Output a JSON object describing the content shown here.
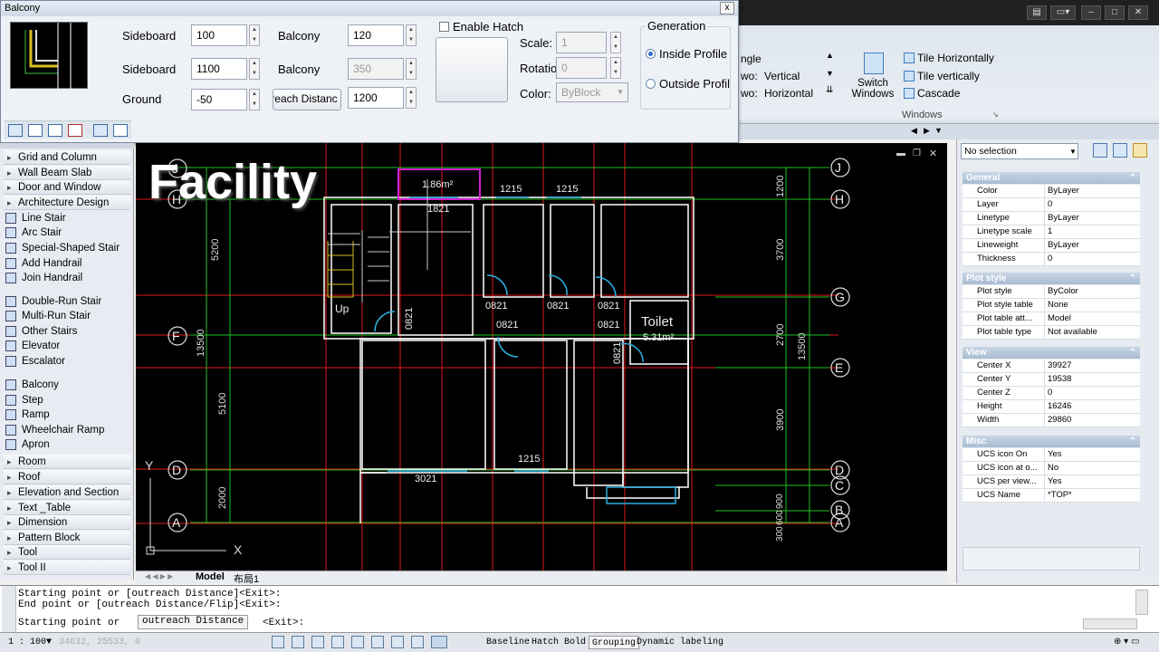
{
  "dialog": {
    "title": "Balcony",
    "close": "x",
    "rows": [
      {
        "label1": "Sideboard",
        "value1": "100",
        "label2": "Balcony",
        "value2": "120"
      },
      {
        "label1": "Sideboard",
        "value1": "1100",
        "label2": "Balcony",
        "value2": "350"
      },
      {
        "label1": "Ground",
        "value1": "-50",
        "button2": "reach Distanc",
        "value2": "1200"
      }
    ],
    "hatch": {
      "checkbox_label": "Enable Hatch",
      "scale_label": "Scale:",
      "scale_value": "1",
      "rotation_label": "Rotatio",
      "rotation_value": "0",
      "color_label": "Color:",
      "color_value": "ByBlock"
    },
    "generation": {
      "title": "Generation",
      "option1": "Inside Profile",
      "option2": "Outside Profil",
      "selected": "Inside Profile"
    }
  },
  "ribbon": {
    "angle_label": "ngle",
    "two_label": "wo:",
    "vertical": "Vertical",
    "two_label_2": "wo:",
    "horizontal": "Horizontal",
    "switch_windows": "Switch Windows",
    "tile_h": "Tile Horizontally",
    "tile_v": "Tile vertically",
    "cascade": "Cascade",
    "group_label": "Windows"
  },
  "left_panel": {
    "items": [
      {
        "type": "head",
        "label": "Grid and Column"
      },
      {
        "type": "head",
        "label": "Wall Beam Slab"
      },
      {
        "type": "head",
        "label": "Door and Window"
      },
      {
        "type": "head",
        "label": "Architecture Design"
      },
      {
        "type": "sub",
        "label": "Line Stair"
      },
      {
        "type": "sub",
        "label": "Arc Stair"
      },
      {
        "type": "sub",
        "label": "Special-Shaped Stair"
      },
      {
        "type": "sub",
        "label": "Add Handrail"
      },
      {
        "type": "sub",
        "label": "Join Handrail"
      },
      {
        "type": "sub",
        "label": "Double-Run Stair"
      },
      {
        "type": "sub",
        "label": "Multi-Run Stair"
      },
      {
        "type": "sub",
        "label": "Other Stairs"
      },
      {
        "type": "sub",
        "label": "Elevator"
      },
      {
        "type": "sub",
        "label": "Escalator"
      },
      {
        "type": "sub",
        "label": "Balcony"
      },
      {
        "type": "sub",
        "label": "Step"
      },
      {
        "type": "sub",
        "label": "Ramp"
      },
      {
        "type": "sub",
        "label": "Wheelchair Ramp"
      },
      {
        "type": "sub",
        "label": "Apron"
      },
      {
        "type": "head",
        "label": "Room"
      },
      {
        "type": "head",
        "label": "Roof"
      },
      {
        "type": "head",
        "label": "Elevation and Section"
      },
      {
        "type": "head",
        "label": "Text _Table"
      },
      {
        "type": "head",
        "label": "Dimension"
      },
      {
        "type": "head",
        "label": "Pattern Block"
      },
      {
        "type": "head",
        "label": "Tool"
      },
      {
        "type": "head",
        "label": "Tool II"
      }
    ]
  },
  "canvas": {
    "overlay_title": "Facility",
    "axis_labels_right": [
      "J",
      "H",
      "G",
      "E",
      "D",
      "C",
      "B",
      "A"
    ],
    "axis_labels_left": [
      "J",
      "H",
      "F",
      "D",
      "A"
    ],
    "dims_left": [
      "5200",
      "13500",
      "5100",
      "2000"
    ],
    "dims_right": [
      "1200",
      "3700",
      "2700",
      "3900",
      "900",
      "600",
      "300",
      "13500"
    ],
    "labels": {
      "area1": "1.86m²",
      "w1821": "1821",
      "d1215a": "1215",
      "d1215b": "1215",
      "up": "Up",
      "d0821a": "0821",
      "d0821b": "0821",
      "d0821c": "0821",
      "d0821d": "0821",
      "d0821e": "0821",
      "d0821f": "0821",
      "d0821g": "0821",
      "toilet": "Toilet",
      "toilet_area": "5.31m²",
      "w3021": "3021",
      "w1215c": "1215"
    },
    "ucs": {
      "x": "X",
      "y": "Y"
    }
  },
  "tabs": {
    "model": "Model",
    "layout": "布局1"
  },
  "properties": {
    "selection": "No selection",
    "sections": [
      {
        "title": "General",
        "rows": [
          [
            "Color",
            "ByLayer"
          ],
          [
            "Layer",
            "0"
          ],
          [
            "Linetype",
            "ByLayer"
          ],
          [
            "Linetype scale",
            "1"
          ],
          [
            "Lineweight",
            "ByLayer"
          ],
          [
            "Thickness",
            "0"
          ]
        ]
      },
      {
        "title": "Plot style",
        "rows": [
          [
            "Plot style",
            "ByColor"
          ],
          [
            "Plot style table",
            "None"
          ],
          [
            "Plot table att...",
            "Model"
          ],
          [
            "Plot table type",
            "Not available"
          ]
        ]
      },
      {
        "title": "View",
        "rows": [
          [
            "Center X",
            "39927"
          ],
          [
            "Center Y",
            "19538"
          ],
          [
            "Center Z",
            "0"
          ],
          [
            "Height",
            "16246"
          ],
          [
            "Width",
            "29860"
          ]
        ]
      },
      {
        "title": "Misc",
        "rows": [
          [
            "UCS icon On",
            "Yes"
          ],
          [
            "UCS icon at o...",
            "No"
          ],
          [
            "UCS per view...",
            "Yes"
          ],
          [
            "UCS Name",
            "*TOP*"
          ]
        ]
      }
    ]
  },
  "command": {
    "line1": "Starting point or [outreach Distance]<Exit>:",
    "line2": "End point or [outreach Distance/Flip]<Exit>:",
    "prompt": "Starting point or",
    "highlight": "outreach Distance",
    "tail": "<Exit>:"
  },
  "status": {
    "scale": "1 : 100▼",
    "coords": "34632, 25533, 0",
    "buttons": [
      "Baseline",
      "Hatch",
      "Bold",
      "Grouping",
      "Dynamic labeling"
    ]
  }
}
